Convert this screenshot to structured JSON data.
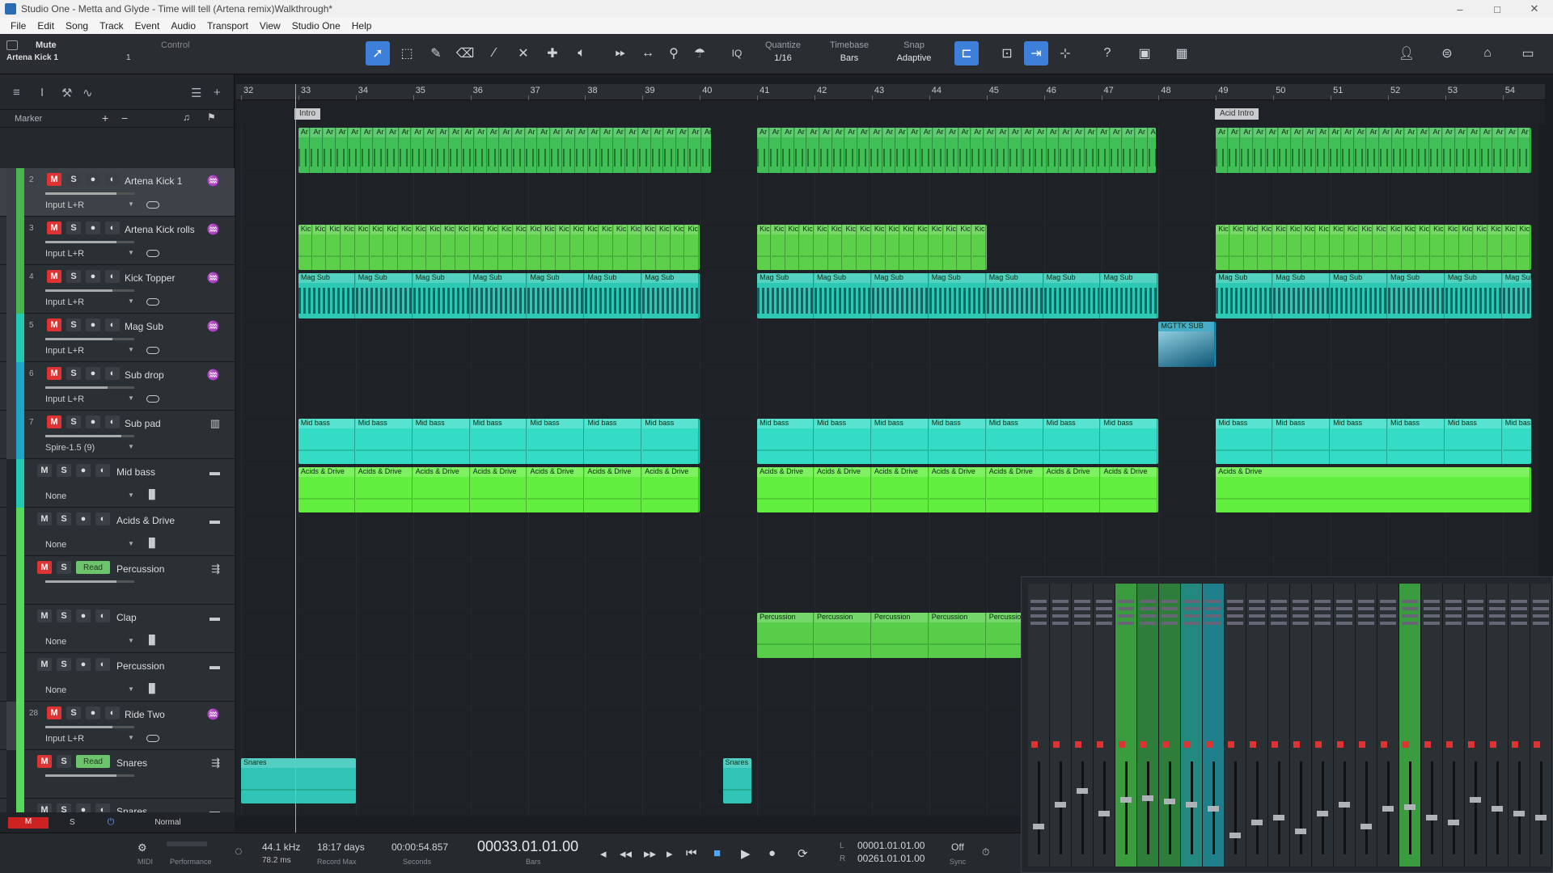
{
  "window": {
    "title": "Studio One - Metta and Glyde - Time will tell (Artena remix)Walkthrough*",
    "controls": [
      "–",
      "□",
      "✕"
    ]
  },
  "menu": [
    "File",
    "Edit",
    "Song",
    "Track",
    "Event",
    "Audio",
    "Transport",
    "View",
    "Studio One",
    "Help"
  ],
  "toolbar": {
    "track_state": "Mute",
    "track_name": "Artena Kick 1",
    "control_label": "Control",
    "channel_num": "1",
    "quantize_label": "Quantize",
    "quantize_value": "1/16",
    "timebase_label": "Timebase",
    "timebase_value": "Bars",
    "snap_label": "Snap",
    "snap_value": "Adaptive",
    "iq_label": "IQ"
  },
  "left": {
    "marker_label": "Marker"
  },
  "ruler": {
    "bars": [
      "32",
      "33",
      "34",
      "35",
      "36",
      "37",
      "38",
      "39",
      "40",
      "41",
      "42",
      "43",
      "44",
      "45",
      "46",
      "47",
      "48",
      "49",
      "50",
      "51",
      "52",
      "53",
      "54"
    ]
  },
  "markers": {
    "intro": "Intro",
    "acid_intro": "Acid Intro"
  },
  "tracks": [
    {
      "num": "2",
      "name": "Artena Kick 1",
      "input": "Input L+R",
      "mute": true,
      "color": "#49b54e",
      "icon": "wave",
      "sel": true,
      "slider": 0.8
    },
    {
      "num": "3",
      "name": "Artena Kick rolls",
      "input": "Input L+R",
      "mute": true,
      "color": "#49b54e",
      "icon": "wave",
      "slider": 0.8
    },
    {
      "num": "4",
      "name": "Kick Topper",
      "input": "Input L+R",
      "mute": true,
      "color": "#49b54e",
      "icon": "wave",
      "slider": 0.75
    },
    {
      "num": "5",
      "name": "Mag Sub",
      "input": "Input L+R",
      "mute": true,
      "color": "#22c9b3",
      "icon": "wave",
      "slider": 0.75
    },
    {
      "num": "6",
      "name": "Sub drop",
      "input": "Input L+R",
      "mute": true,
      "color": "#1ea5c8",
      "icon": "wave",
      "slider": 0.7
    },
    {
      "num": "7",
      "name": "Sub pad",
      "input": "Spire-1.5 (9)",
      "mute": true,
      "color": "#1ea5c8",
      "icon": "keys",
      "slider": 0.85
    },
    {
      "num": "",
      "name": "Mid bass",
      "input": "None",
      "mute": false,
      "color": "#22c9b3",
      "icon": "folder"
    },
    {
      "num": "",
      "name": "Acids & Drive",
      "input": "None",
      "mute": false,
      "color": "#56d85a",
      "icon": "folder"
    },
    {
      "num": "",
      "name": "Percussion",
      "input": "",
      "mute": true,
      "color": "#56d85a",
      "icon": "bus",
      "read": "Read",
      "slider": 0.8
    },
    {
      "num": "",
      "name": "Clap",
      "input": "None",
      "mute": false,
      "color": "#56d85a",
      "icon": "folder"
    },
    {
      "num": "",
      "name": "Percussion",
      "input": "None",
      "mute": false,
      "color": "#56d85a",
      "icon": "folder"
    },
    {
      "num": "28",
      "name": "Ride Two",
      "input": "Input L+R",
      "mute": true,
      "color": "#56d85a",
      "icon": "wave",
      "slider": 0.75
    },
    {
      "num": "",
      "name": "Snares",
      "input": "",
      "mute": true,
      "color": "#56d85a",
      "icon": "bus",
      "read": "Read",
      "slider": 0.8
    },
    {
      "num": "",
      "name": "Snares",
      "input": "",
      "mute": false,
      "color": "#56d85a",
      "icon": "folder"
    }
  ],
  "clip_labels": {
    "kick": "Ar",
    "kick_topper": "Kic",
    "mag_sub": "Mag Sub",
    "sub_drop": "MGTTK SUB",
    "mid_bass": "Mid bass",
    "acids": "Acids & Drive",
    "percussion": "Percussion",
    "snares": "Snares"
  },
  "footer": {
    "m": "M",
    "s": "S",
    "mode": "Normal"
  },
  "transport": {
    "midi": "MIDI",
    "performance": "Performance",
    "sample_rate": "44.1 kHz",
    "latency": "78.2 ms",
    "record_max": "18:17 days",
    "record_max_label": "Record Max",
    "seconds": "00:00:54.857",
    "seconds_label": "Seconds",
    "position": "00033.01.01.00",
    "bars_label": "Bars",
    "left_loc": "00001.01.01.00",
    "right_loc": "00261.01.01.00",
    "l": "L",
    "r": "R",
    "sync_off": "Off",
    "sync_label": "Sync"
  }
}
